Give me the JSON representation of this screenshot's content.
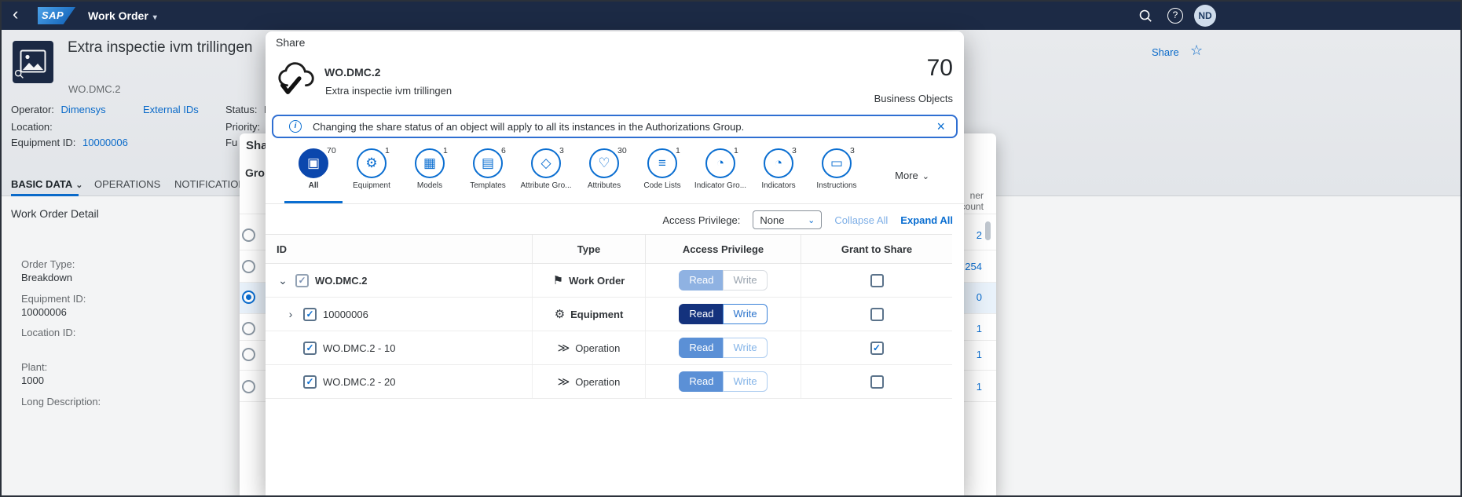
{
  "shell": {
    "brand": "SAP",
    "app_title": "Work Order",
    "help_glyph": "?",
    "avatar_initials": "ND"
  },
  "icons": {
    "back": "‹",
    "title_chevron": "▾",
    "star": "☆",
    "check": "✓",
    "close": "×",
    "info_glyph": "i",
    "chevron_down": "⌄",
    "chevron_right": "›",
    "select_chevron": "⌄",
    "more_chevron": "⌄"
  },
  "page": {
    "title": "Extra inspectie ivm trillingen",
    "subtitle": "WO.DMC.2",
    "share_action": "Share",
    "fields": {
      "operator_label": "Operator:",
      "operator_value": "Dimensys",
      "external_ids_link": "External IDs",
      "status_label": "Status:",
      "status_value_truncated": "P",
      "location_label": "Location:",
      "priority_label": "Priority:",
      "equipment_label": "Equipment ID:",
      "equipment_value": "10000006",
      "truncated_field_label": "Fu"
    },
    "tabs": [
      {
        "label": "BASIC DATA",
        "selected": true
      },
      {
        "label": "OPERATIONS",
        "selected": false
      },
      {
        "label": "NOTIFICATION",
        "selected": false
      }
    ],
    "detail": {
      "heading": "Work Order Detail",
      "fields": [
        {
          "label": "Order Type:",
          "value": "Breakdown"
        },
        {
          "label": "Equipment ID:",
          "value": "10000006"
        },
        {
          "label": "Location ID:",
          "value": ""
        },
        {
          "label": "Plant:",
          "value": "1000"
        },
        {
          "label": "Long Description:",
          "value": ""
        }
      ]
    }
  },
  "background_dialog": {
    "title_truncated": "Sha",
    "subtitle_truncated": "Gro",
    "count_header_top": "ner",
    "count_header_bottom": "count",
    "counts": [
      "2",
      "254",
      "0",
      "1",
      "1",
      "1"
    ],
    "selected_row_index": 2
  },
  "dialog": {
    "title": "Share",
    "object_name": "WO.DMC.2",
    "object_description": "Extra inspectie ivm trillingen",
    "total_count": "70",
    "total_label": "Business Objects",
    "banner_text": "Changing the share status of an object will apply to all its instances in the Authorizations Group.",
    "tabs": [
      {
        "label": "All",
        "count": "70",
        "glyph": "▣",
        "selected": true
      },
      {
        "label": "Equipment",
        "count": "1",
        "glyph": "⚙",
        "selected": false
      },
      {
        "label": "Models",
        "count": "1",
        "glyph": "▦",
        "selected": false
      },
      {
        "label": "Templates",
        "count": "6",
        "glyph": "▤",
        "selected": false
      },
      {
        "label": "Attribute Gro...",
        "count": "3",
        "glyph": "◇",
        "selected": false
      },
      {
        "label": "Attributes",
        "count": "30",
        "glyph": "♡",
        "selected": false
      },
      {
        "label": "Code Lists",
        "count": "1",
        "glyph": "≡",
        "selected": false
      },
      {
        "label": "Indicator Gro...",
        "count": "1",
        "glyph": "◔",
        "selected": false
      },
      {
        "label": "Indicators",
        "count": "3",
        "glyph": "◔",
        "selected": false
      },
      {
        "label": "Instructions",
        "count": "3",
        "glyph": "▭",
        "selected": false
      }
    ],
    "more_label": "More",
    "toolbar": {
      "access_privilege_label": "Access Privilege:",
      "access_privilege_value": "None",
      "collapse_all": "Collapse All",
      "expand_all": "Expand All"
    },
    "table": {
      "columns": [
        "ID",
        "Type",
        "Access Privilege",
        "Grant to Share"
      ],
      "read_label": "Read",
      "write_label": "Write",
      "rows": [
        {
          "id": "WO.DMC.2",
          "type": "Work Order",
          "type_glyph": "⚑",
          "expanded": true,
          "checked": true,
          "read_state": "selected-muted",
          "write_state": "disabled",
          "grant_checked": false
        },
        {
          "id": "10000006",
          "type": "Equipment",
          "type_glyph": "⚙",
          "expanded": false,
          "checked": true,
          "read_state": "selected-dark",
          "write_state": "enabled",
          "grant_checked": false
        },
        {
          "id": "WO.DMC.2 - 10",
          "type": "Operation",
          "type_glyph": "≫",
          "checked": true,
          "read_state": "selected",
          "write_state": "enabled-light",
          "grant_checked": true
        },
        {
          "id": "WO.DMC.2 - 20",
          "type": "Operation",
          "type_glyph": "≫",
          "checked": true,
          "read_state": "selected",
          "write_state": "enabled-light",
          "grant_checked": false
        }
      ]
    }
  }
}
